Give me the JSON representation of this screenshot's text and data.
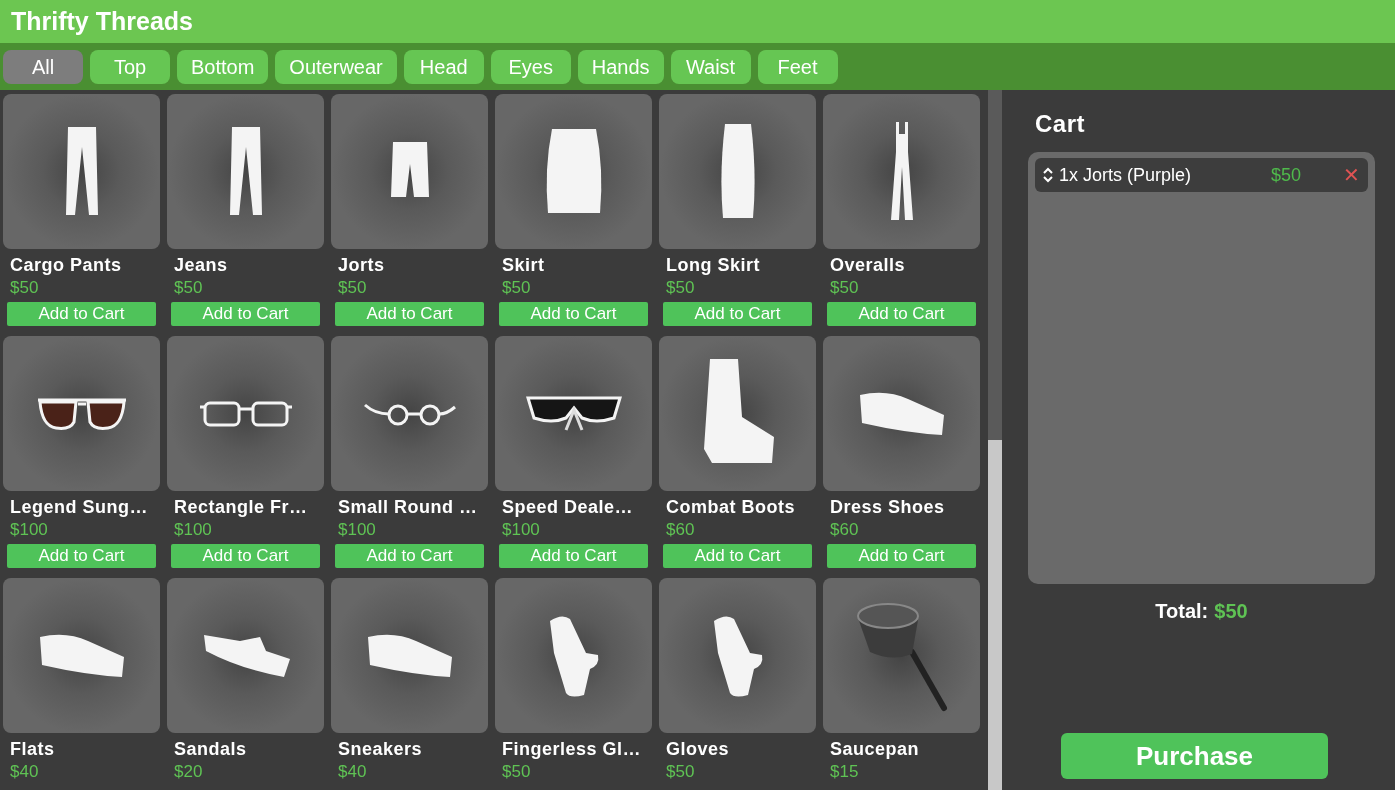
{
  "window": {
    "title": "Thrifty Threads"
  },
  "tabs": [
    {
      "label": "All",
      "selected": true
    },
    {
      "label": "Top",
      "selected": false
    },
    {
      "label": "Bottom",
      "selected": false
    },
    {
      "label": "Outerwear",
      "selected": false
    },
    {
      "label": "Head",
      "selected": false
    },
    {
      "label": "Eyes",
      "selected": false
    },
    {
      "label": "Hands",
      "selected": false
    },
    {
      "label": "Waist",
      "selected": false
    },
    {
      "label": "Feet",
      "selected": false
    }
  ],
  "items": [
    {
      "name": "Cargo Pants",
      "price": "$50",
      "button": "Add to Cart",
      "kind": "pants"
    },
    {
      "name": "Jeans",
      "price": "$50",
      "button": "Add to Cart",
      "kind": "pants"
    },
    {
      "name": "Jorts",
      "price": "$50",
      "button": "Add to Cart",
      "kind": "shorts"
    },
    {
      "name": "Skirt",
      "price": "$50",
      "button": "Add to Cart",
      "kind": "skirt"
    },
    {
      "name": "Long Skirt",
      "price": "$50",
      "button": "Add to Cart",
      "kind": "longskirt"
    },
    {
      "name": "Overalls",
      "price": "$50",
      "button": "Add to Cart",
      "kind": "overalls"
    },
    {
      "name": "Legend Sung…",
      "price": "$100",
      "button": "Add to Cart",
      "kind": "sunglasses"
    },
    {
      "name": "Rectangle Fr…",
      "price": "$100",
      "button": "Add to Cart",
      "kind": "glasses"
    },
    {
      "name": "Small Round …",
      "price": "$100",
      "button": "Add to Cart",
      "kind": "roundglasses"
    },
    {
      "name": "Speed Deale…",
      "price": "$100",
      "button": "Add to Cart",
      "kind": "visor"
    },
    {
      "name": "Combat Boots",
      "price": "$60",
      "button": "Add to Cart",
      "kind": "boot"
    },
    {
      "name": "Dress Shoes",
      "price": "$60",
      "button": "Add to Cart",
      "kind": "shoe"
    },
    {
      "name": "Flats",
      "price": "$40",
      "kind": "shoe"
    },
    {
      "name": "Sandals",
      "price": "$20",
      "kind": "sandal"
    },
    {
      "name": "Sneakers",
      "price": "$40",
      "kind": "shoe"
    },
    {
      "name": "Fingerless Gl…",
      "price": "$50",
      "kind": "glove"
    },
    {
      "name": "Gloves",
      "price": "$50",
      "kind": "glove"
    },
    {
      "name": "Saucepan",
      "price": "$15",
      "kind": "saucepan"
    }
  ],
  "cart": {
    "title": "Cart",
    "items": [
      {
        "label": "1x Jorts (Purple)",
        "price": "$50",
        "remove": "✕"
      }
    ],
    "total_label": "Total:",
    "total_value": "$50",
    "purchase": "Purchase"
  }
}
